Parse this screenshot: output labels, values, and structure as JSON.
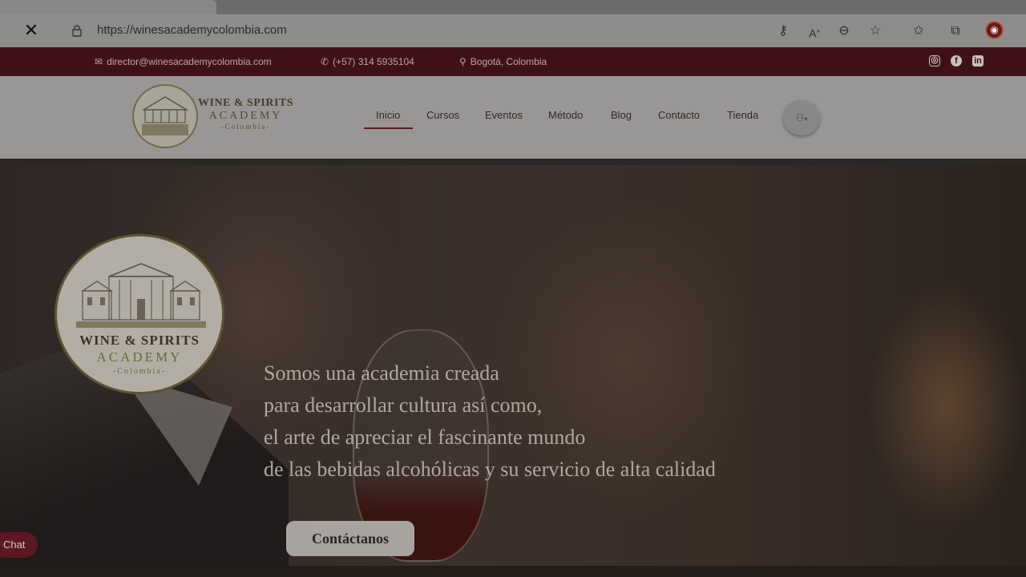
{
  "browser": {
    "url": "https://winesacademycolombia.com",
    "close_icon": "close-icon",
    "icons": [
      "key-icon",
      "read-aloud-icon",
      "zoom-icon",
      "add-favorite-icon",
      "favorites-icon",
      "collections-icon",
      "profile-icon"
    ]
  },
  "infobar": {
    "email": "director@winesacademycolombia.com",
    "phone": "(+57) 314 5935104",
    "location": "Bogotá, Colombia",
    "social": [
      "instagram-icon",
      "facebook-icon",
      "linkedin-icon"
    ]
  },
  "header": {
    "logo": {
      "line1": "WINE & SPIRITS",
      "line2": "ACADEMY",
      "line3": "-Colombia-"
    },
    "nav": [
      "Inicio",
      "Cursos",
      "Eventos",
      "Método",
      "Blog",
      "Contacto",
      "Tienda"
    ],
    "active_nav": "Inicio"
  },
  "hero": {
    "logo": {
      "line1": "WINE & SPIRITS",
      "line2": "ACADEMY",
      "line3": "-Colombia-"
    },
    "lines": [
      "Somos una academia creada",
      "para desarrollar cultura así como,",
      "el arte de apreciar el fascinante mundo",
      "de las bebidas alcohólicas y su servicio de alta calidad"
    ],
    "cta": "Contáctanos"
  },
  "chat": {
    "label": "Chat"
  },
  "colors": {
    "brand": "#3f1117",
    "accent": "#5c1820"
  }
}
